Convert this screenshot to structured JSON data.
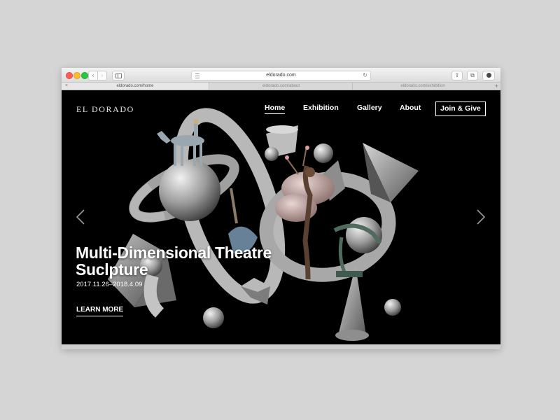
{
  "browser": {
    "address": "eldorado.com",
    "tabs": [
      {
        "label": "eldorado.com/home"
      },
      {
        "label": "eldorado.com/about"
      },
      {
        "label": "eldorado.com/exhibition"
      }
    ]
  },
  "site": {
    "logo": "EL DORADO",
    "nav": [
      {
        "label": "Home"
      },
      {
        "label": "Exhibition"
      },
      {
        "label": "Gallery"
      },
      {
        "label": "About"
      }
    ],
    "cta": "Join & Give"
  },
  "hero": {
    "title_line1": "Multi-Dimensional Theatre",
    "title_line2": "Suclpture",
    "dates": "2017.11.26–2018.4.09",
    "link": "LEARN MORE"
  },
  "icons": {
    "prev": "chevron-left-icon",
    "next": "chevron-right-icon"
  }
}
